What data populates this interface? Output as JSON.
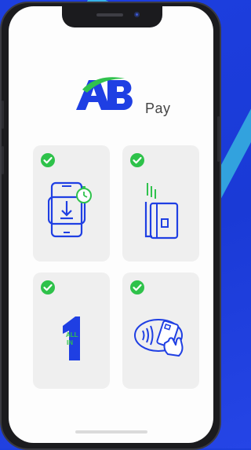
{
  "app": {
    "logo_text": "AB",
    "logo_suffix": "Pay"
  },
  "features": [
    {
      "icon": "mobile-download-timer-icon",
      "enabled": true
    },
    {
      "icon": "card-reader-icon",
      "enabled": true
    },
    {
      "icon": "all-in-one-icon",
      "enabled": true,
      "icon_text": "ALL IN"
    },
    {
      "icon": "contactless-card-tap-icon",
      "enabled": true
    }
  ],
  "colors": {
    "background": "#1d3fe0",
    "brand_blue": "#1f3fe3",
    "brand_green": "#30c24d",
    "check_green": "#2ec24a",
    "card_bg": "#efefef"
  }
}
